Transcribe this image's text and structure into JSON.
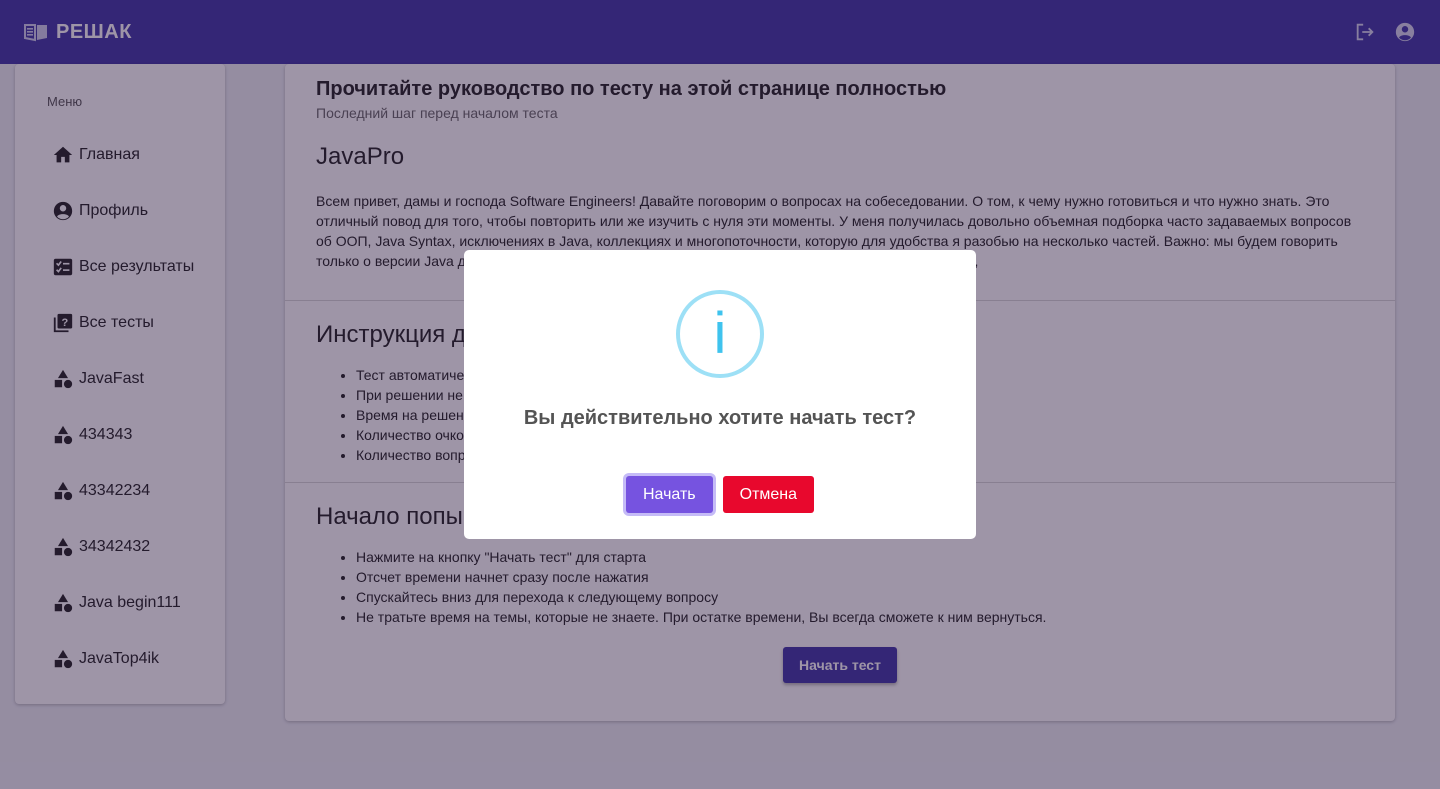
{
  "app": {
    "brand": "РЕШАК"
  },
  "sidebar": {
    "heading": "Меню",
    "items": [
      {
        "label": "Главная",
        "icon": "home-icon"
      },
      {
        "label": "Профиль",
        "icon": "account-circle-icon"
      },
      {
        "label": "Все результаты",
        "icon": "fact-check-icon"
      },
      {
        "label": "Все тесты",
        "icon": "quiz-icon"
      },
      {
        "label": "JavaFast",
        "icon": "category-icon"
      },
      {
        "label": "434343",
        "icon": "category-icon"
      },
      {
        "label": "43342234",
        "icon": "category-icon"
      },
      {
        "label": "34342432",
        "icon": "category-icon"
      },
      {
        "label": "Java begin111",
        "icon": "category-icon"
      },
      {
        "label": "JavaTop4ik",
        "icon": "category-icon"
      }
    ]
  },
  "main": {
    "title": "Прочитайте руководство по тесту на этой странице полностью",
    "subtitle": "Последний шаг перед началом теста",
    "test_name": "JavaPro",
    "description": "Всем привет, дамы и господа Software Engineers! Давайте поговорим о вопросах на собеседовании. О том, к чему нужно готовиться и что нужно знать. Это отличный повод для того, чтобы повторить или же изучить с нуля эти моменты. У меня получилась довольно объемная подборка часто задаваемых вопросов об ООП, Java Syntax, исключениях в Java, коллекциях и многопоточности, которую для удобства я разобью на несколько частей. Важно: мы будем говорить только о версии Java д                                                                                                                  идеи/замечания, как улучшить ответы, приветствуются. Приятного прочтения,",
    "instructions_title": "Инструкция д",
    "instructions": [
      "Тест автоматичес                                                                                                        рете браузер.",
      "При решении не                                                                                                          рего преподавателя.",
      "Время на решени",
      "Количество очко                                                                                                          м.",
      "Количество вопр"
    ],
    "start_title": "Начало попы",
    "start_steps": [
      "Нажмите на кнопку \"Начать тест\" для старта",
      "Отсчет времени начнет сразу после нажатия",
      "Спускайтесь вниз для перехода к следующему вопросу",
      "Не тратьте время на темы, которые не знаете. При остатке времени, Вы всегда сможете к ним вернуться."
    ],
    "start_button": "Начать тест"
  },
  "dialog": {
    "icon": "info-icon",
    "glyph": "i",
    "question": "Вы действительно хотите начать тест?",
    "confirm": "Начать",
    "cancel": "Отмена"
  },
  "colors": {
    "appbar": "#3f35a6",
    "confirm": "#7653e0",
    "cancel": "#e8082d",
    "info": "#3fc3ee"
  }
}
